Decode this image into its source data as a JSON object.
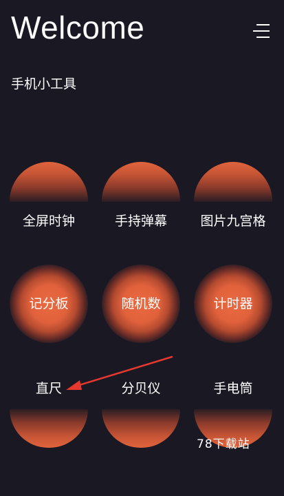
{
  "header": {
    "title": "Welcome",
    "menu_icon": "hamburger-menu-icon"
  },
  "subtitle": "手机小工具",
  "tools_row1": [
    {
      "label": "全屏时钟"
    },
    {
      "label": "手持弹幕"
    },
    {
      "label": "图片九宫格"
    }
  ],
  "tools_row2": [
    {
      "label": "记分板"
    },
    {
      "label": "随机数"
    },
    {
      "label": "计时器"
    }
  ],
  "tools_row3": [
    {
      "label": "直尺"
    },
    {
      "label": "分贝仪"
    },
    {
      "label": "手电筒"
    }
  ],
  "annotation": {
    "arrow_icon": "red-arrow-icon",
    "color": "#e5382f"
  },
  "watermark": "78下载站",
  "colors": {
    "background": "#191823",
    "accent": "#e0643d"
  }
}
